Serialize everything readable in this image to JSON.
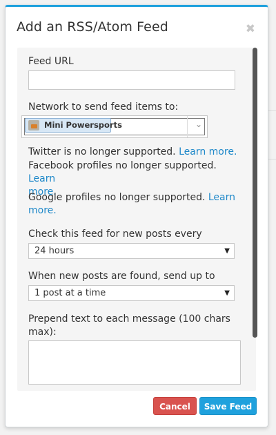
{
  "modal": {
    "title": "Add an RSS/Atom Feed",
    "close_icon": "close-x-icon"
  },
  "form": {
    "feed_url": {
      "label": "Feed URL",
      "value": "",
      "placeholder": ""
    },
    "network": {
      "label": "Network to send feed items to:",
      "selected": "Mini Powersports",
      "icon": "account-avatar-icon"
    },
    "notices": {
      "twitter": "Twitter is no longer supported.",
      "facebook": "Facebook profiles no longer supported.",
      "google": "Google profiles no longer supported.",
      "learn_more": "Learn more.",
      "learn_more_split_1": "Learn",
      "learn_more_split_2": "more."
    },
    "frequency": {
      "label": "Check this feed for new posts every",
      "selected": "24 hours"
    },
    "send_up_to": {
      "label": "When new posts are found, send up to",
      "selected": "1 post at a time"
    },
    "prepend": {
      "label_line1": "Prepend text to each message (100 chars",
      "label_line2": "max):",
      "value": ""
    }
  },
  "buttons": {
    "cancel": "Cancel",
    "save": "Save Feed"
  },
  "colors": {
    "accent": "#1fa1dd",
    "cancel": "#d9534f",
    "link": "#1e88c9"
  }
}
